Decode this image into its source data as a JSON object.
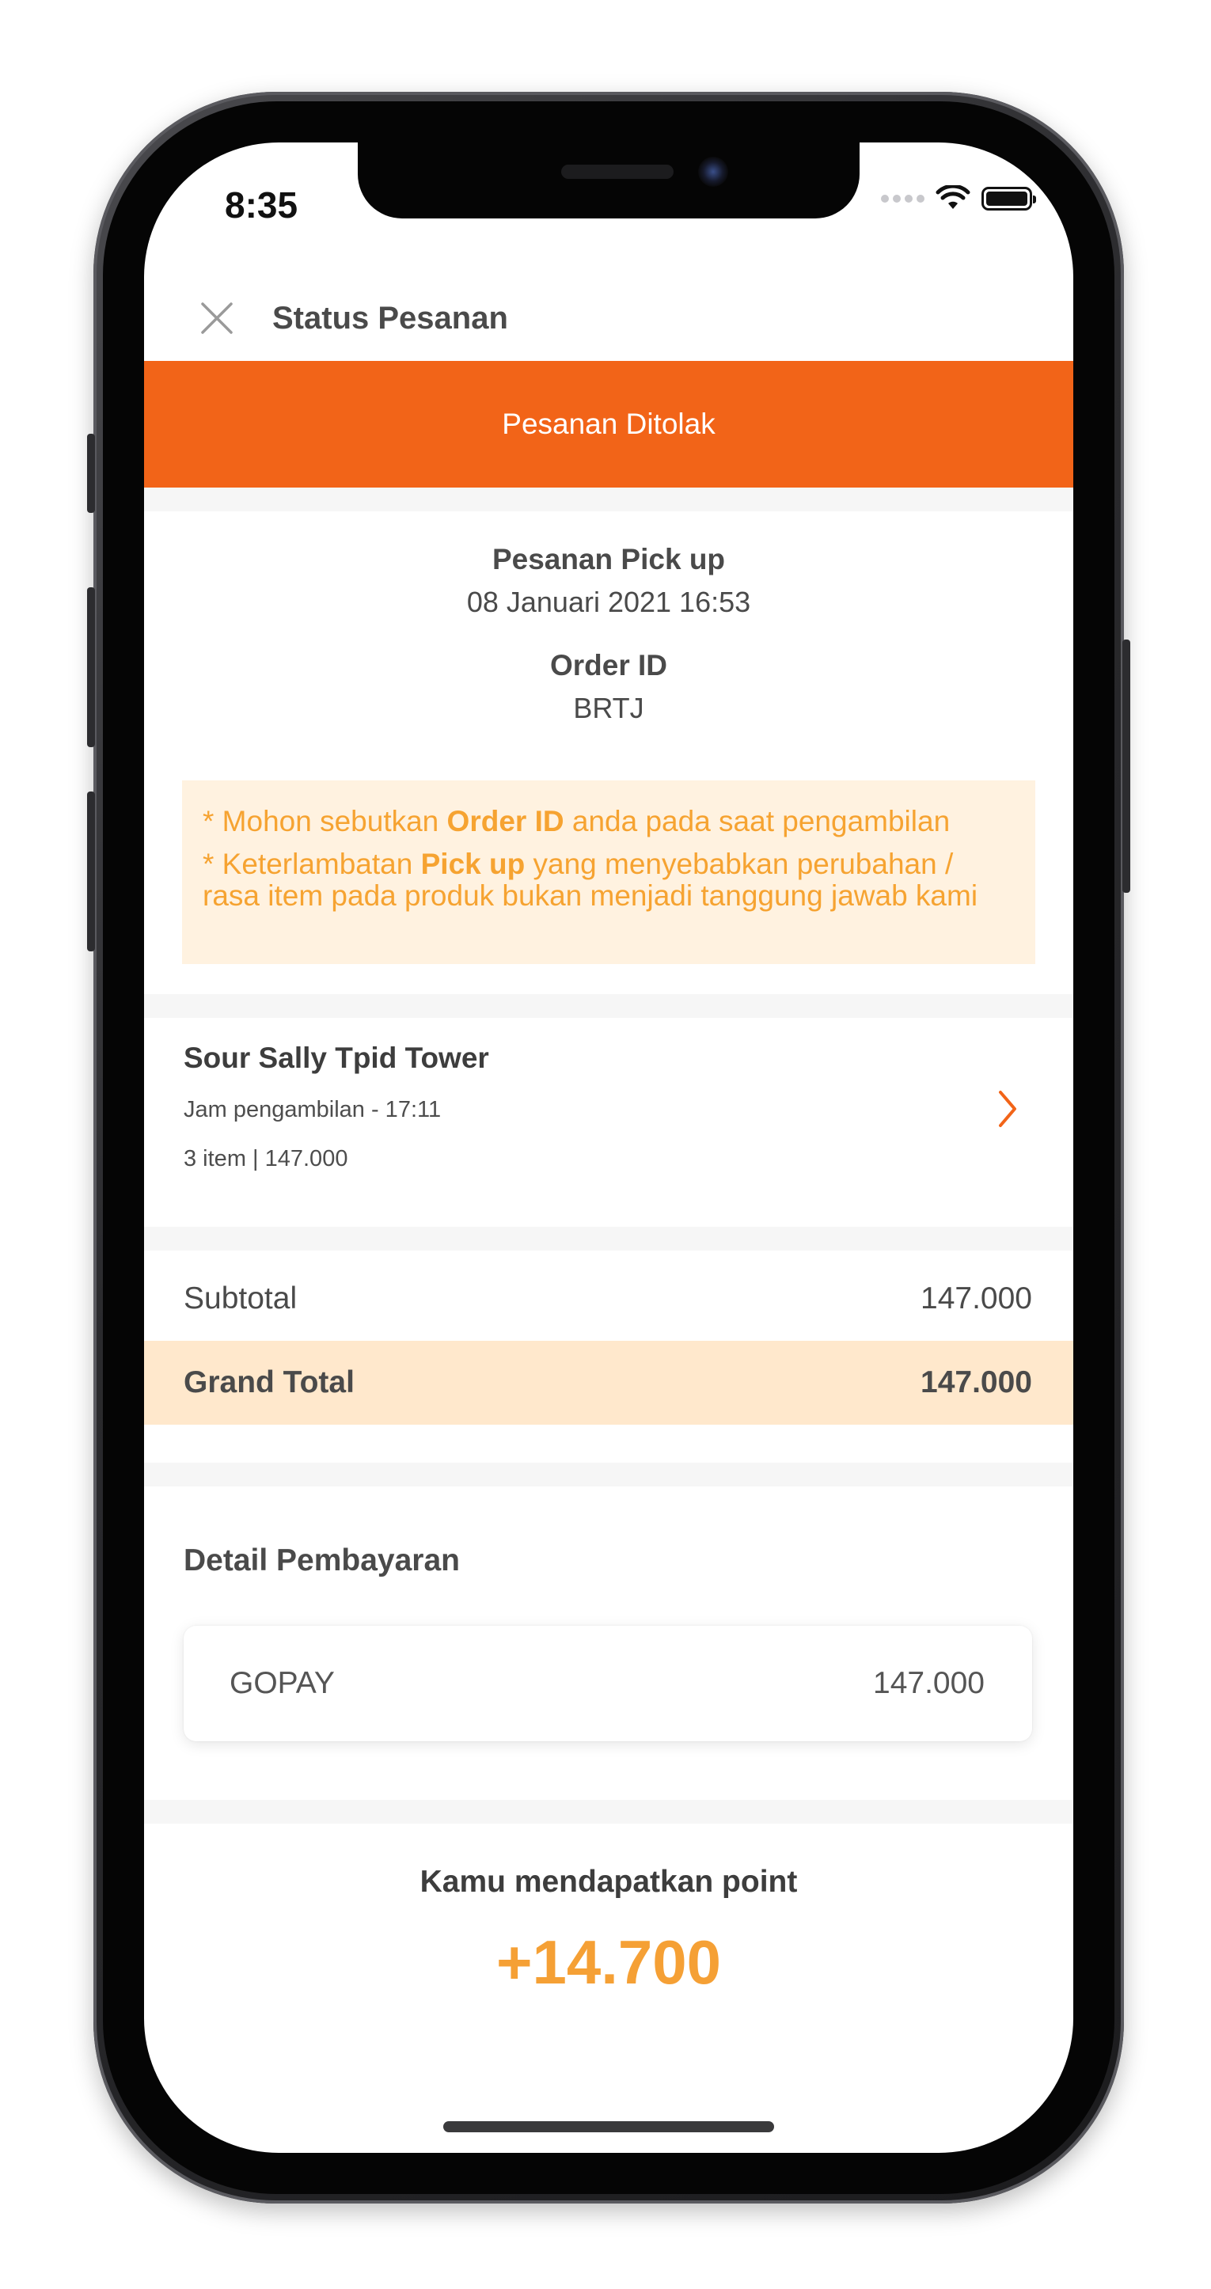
{
  "status_bar": {
    "time": "8:35",
    "icons": [
      "cellular-signal-icon",
      "wifi-icon",
      "battery-icon"
    ]
  },
  "header": {
    "title": "Status Pesanan",
    "close_icon": "close-icon"
  },
  "banner": {
    "label": "Pesanan Ditolak",
    "color": "#f26418"
  },
  "order": {
    "type": "Pesanan Pick up",
    "datetime": "08 Januari 2021 16:53",
    "id_label": "Order ID",
    "id_value": "BRTJ"
  },
  "notice": {
    "line1_prefix": "* Mohon sebutkan ",
    "line1_bold": "Order ID",
    "line1_suffix": " anda pada saat pengambilan",
    "line2_prefix": "* Keterlambatan ",
    "line2_bold": "Pick up",
    "line2_suffix": " yang menyebabkan perubahan /",
    "line3": "rasa item pada produk bukan menjadi tanggung jawab kami"
  },
  "store": {
    "name": "Sour Sally Tpid Tower",
    "pickup_time": "Jam pengambilan - 17:11",
    "summary": "3 item | 147.000"
  },
  "totals": {
    "subtotal_label": "Subtotal",
    "subtotal_value": "147.000",
    "grand_label": "Grand Total",
    "grand_value": "147.000"
  },
  "payment": {
    "section_title": "Detail Pembayaran",
    "method": "GOPAY",
    "amount": "147.000"
  },
  "points": {
    "label": "Kamu mendapatkan point",
    "value": "+14.700",
    "color": "#f5a035"
  }
}
